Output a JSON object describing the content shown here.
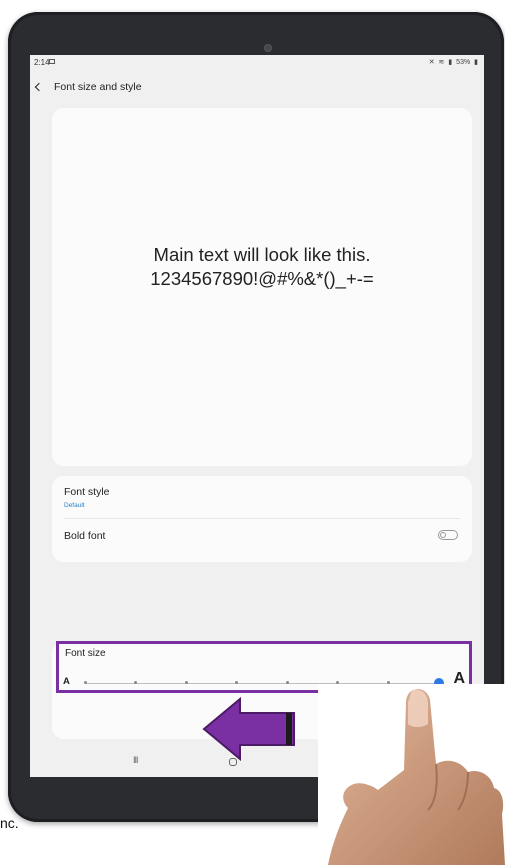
{
  "status_bar": {
    "time": "2:14",
    "icons": [
      "notification-mute-icon",
      "wifi-icon",
      "signal-icon"
    ],
    "battery": "53%"
  },
  "header": {
    "title": "Font size and style"
  },
  "preview": {
    "line1": "Main text will look like this.",
    "line2": "1234567890!@#%&*()_+-="
  },
  "settings": {
    "font_style": {
      "title": "Font style",
      "value": "Default"
    },
    "bold_font": {
      "title": "Bold font",
      "enabled": false
    }
  },
  "font_size": {
    "label": "Font size",
    "small_label": "A",
    "large_label": "A",
    "steps": 8,
    "selected_step": 8
  },
  "navbar": {
    "recent": "III",
    "back": "<"
  },
  "caption": {
    "text": "nc."
  },
  "colors": {
    "highlight": "#7a2fa3",
    "arrow": "#7a2fa3",
    "accent": "#2c7be5",
    "link": "#2a82c9"
  }
}
